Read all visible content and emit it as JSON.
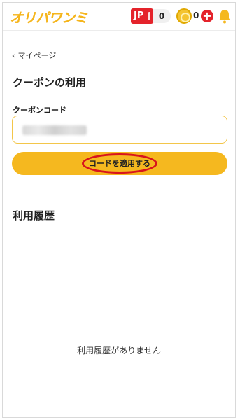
{
  "header": {
    "logo_text": "オリパワンミ",
    "jp_badge_label": "JP",
    "jp_count": "0",
    "coin_count": "0",
    "colors": {
      "brand_yellow": "#f5b81f",
      "badge_red": "#e4232b"
    }
  },
  "breadcrumb": {
    "chevron": "‹",
    "label": "マイページ"
  },
  "page": {
    "title": "クーポンの利用"
  },
  "coupon_form": {
    "field_label": "クーポンコード",
    "input_value": "",
    "apply_button_label": "コードを適用する"
  },
  "history": {
    "title": "利用履歴",
    "empty_message": "利用履歴がありません"
  },
  "icons": [
    "coin-icon",
    "plus-icon",
    "bell-icon",
    "chevron-left-icon"
  ]
}
